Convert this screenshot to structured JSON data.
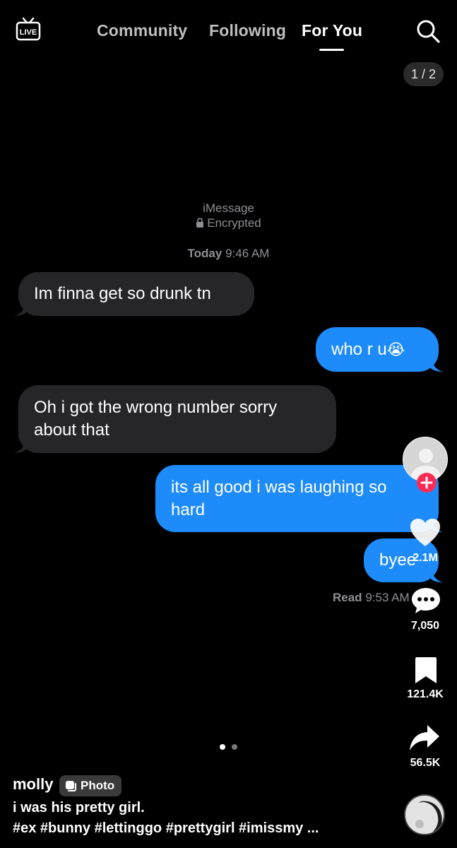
{
  "header": {
    "live_label": "LIVE",
    "tabs": [
      {
        "label": "Community"
      },
      {
        "label": "Following"
      },
      {
        "label": "For You",
        "active": true
      }
    ],
    "search_icon": "search-icon"
  },
  "photo_counter": "1 / 2",
  "conversation": {
    "service": "iMessage",
    "encrypted": "Encrypted",
    "timestamp_day": "Today",
    "timestamp_time": "9:46 AM",
    "messages": [
      {
        "from": "them",
        "text": "Im finna get so drunk tn"
      },
      {
        "from": "me",
        "text": "who r u",
        "emoji": "😭"
      },
      {
        "from": "them",
        "text": "Oh i got the wrong number sorry about that"
      },
      {
        "from": "me",
        "text": "its all good i was laughing so hard"
      },
      {
        "from": "me",
        "text": "byee"
      }
    ],
    "read_label": "Read",
    "read_time": "9:53 AM"
  },
  "rail": {
    "follow_icon": "plus-icon",
    "likes": "2.1M",
    "comments": "7,050",
    "saves": "121.4K",
    "shares": "56.5K"
  },
  "post": {
    "username": "molly",
    "badge_label": "Photo",
    "caption": "i was his pretty girl.",
    "hashtags": "#ex #bunny #lettinggo #prettygirl #imissmy ..."
  },
  "colors": {
    "background": "#000000",
    "sent_bubble": "#1e8bfa",
    "received_bubble": "#262628",
    "follow_badge": "#fe2c55"
  }
}
